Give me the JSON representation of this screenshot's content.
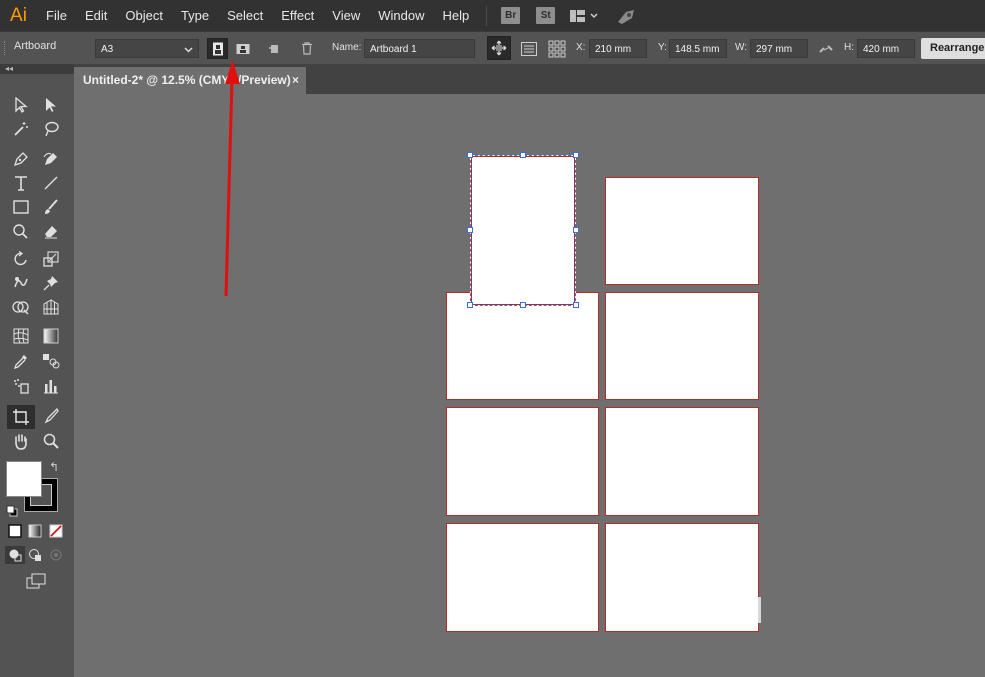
{
  "app": {
    "logo": "Ai"
  },
  "menu": [
    "File",
    "Edit",
    "Object",
    "Type",
    "Select",
    "Effect",
    "View",
    "Window",
    "Help"
  ],
  "app_buttons": {
    "bridge": "Br",
    "stock": "St"
  },
  "control_bar": {
    "tool_name": "Artboard",
    "preset": "A3",
    "name_label": "Name:",
    "name_value": "Artboard 1",
    "x_label": "X:",
    "x_value": "210 mm",
    "y_label": "Y:",
    "y_value": "148.5 mm",
    "w_label": "W:",
    "w_value": "297 mm",
    "h_label": "H:",
    "h_value": "420 mm",
    "rearrange_label": "Rearrange All"
  },
  "document_tab": {
    "title": "Untitled-2* @ 12.5% (CMYK/Preview)",
    "close": "×"
  },
  "toolbar": {
    "collapse": "◂◂",
    "swap": "↰"
  },
  "colors": {
    "menubar_bg": "#323232",
    "panel_bg": "#535353",
    "canvas_bg": "#6f6f6f",
    "logo_accent": "#ff9a00",
    "artboard_border": "#b52a2a",
    "selection_blue": "#3a6fd3",
    "annotation_red": "#e01010"
  },
  "canvas": {
    "artboard_count": 8,
    "selected_artboard": "Artboard 1"
  }
}
